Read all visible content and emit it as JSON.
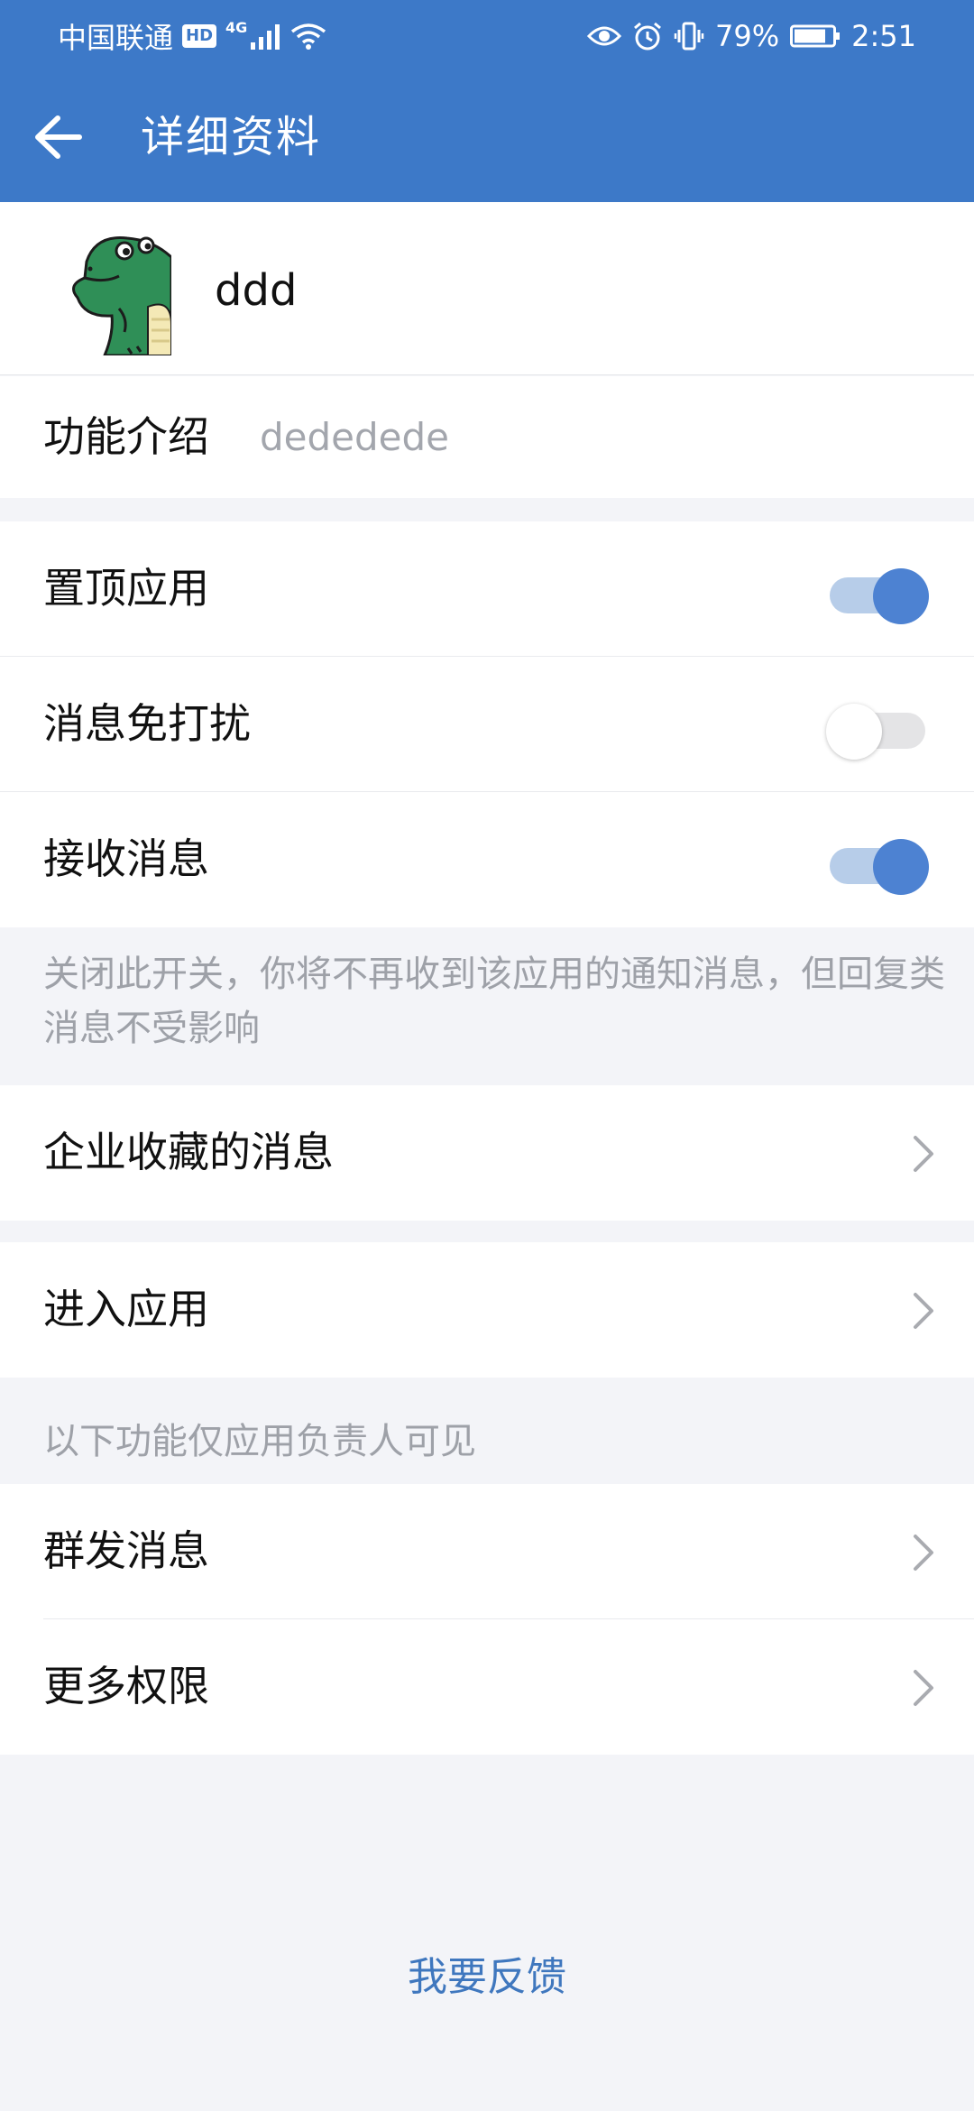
{
  "status_bar": {
    "carrier": "中国联通",
    "hd": "HD",
    "network": "4G",
    "battery": "79%",
    "time": "2:51"
  },
  "appbar": {
    "title": "详细资料"
  },
  "profile": {
    "name": "ddd"
  },
  "intro": {
    "label": "功能介绍",
    "value": "dededede"
  },
  "settings": {
    "pin_app": {
      "label": "置顶应用",
      "enabled": true
    },
    "do_not_disturb": {
      "label": "消息免打扰",
      "enabled": false
    },
    "receive_messages": {
      "label": "接收消息",
      "enabled": true
    }
  },
  "hint": "关闭此开关，你将不再收到该应用的通知消息，但回复类消息不受影响",
  "menu": {
    "saved_messages": "企业收藏的消息",
    "enter_app": "进入应用"
  },
  "admin_section": {
    "label": "以下功能仅应用负责人可见",
    "broadcast": "群发消息",
    "more_permissions": "更多权限"
  },
  "feedback": "我要反馈",
  "colors": {
    "header_bg": "#3d79c8",
    "switch_on": "#4d82d2",
    "link_blue": "#3f77be"
  }
}
